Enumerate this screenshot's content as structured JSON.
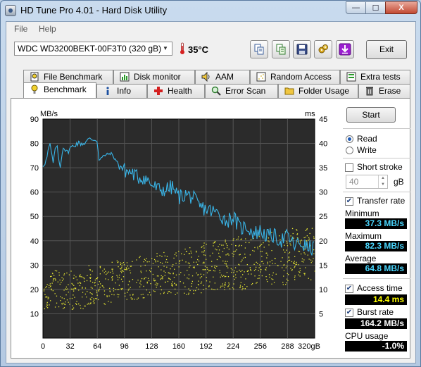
{
  "window": {
    "title": "HD Tune Pro 4.01 - Hard Disk Utility",
    "min": "—",
    "max": "☐",
    "close": "X"
  },
  "menu": {
    "file": "File",
    "help": "Help"
  },
  "toolbar": {
    "drive": "WDC WD3200BEKT-00F3T0 (320 gB)",
    "temperature": "35°C",
    "exit_label": "Exit",
    "icons": [
      "copy-icon",
      "copy-info-icon",
      "save-icon",
      "options-icon",
      "download-icon"
    ]
  },
  "tabs_top": [
    "File Benchmark",
    "Disk monitor",
    "AAM",
    "Random Access",
    "Extra tests"
  ],
  "tabs_bottom": [
    "Benchmark",
    "Info",
    "Health",
    "Error Scan",
    "Folder Usage",
    "Erase"
  ],
  "active_tab": "Benchmark",
  "side": {
    "start_label": "Start",
    "read_label": "Read",
    "write_label": "Write",
    "mode": "Read",
    "short_stroke_label": "Short stroke",
    "short_stroke_checked": false,
    "short_stroke_value": "40",
    "gb_label": "gB",
    "transfer_rate_label": "Transfer rate",
    "transfer_rate_checked": true,
    "minimum_label": "Minimum",
    "minimum_value": "37.3 MB/s",
    "maximum_label": "Maximum",
    "maximum_value": "82.3 MB/s",
    "average_label": "Average",
    "average_value": "64.8 MB/s",
    "access_time_label": "Access time",
    "access_time_checked": true,
    "access_time_value": "14.4 ms",
    "burst_rate_label": "Burst rate",
    "burst_rate_checked": true,
    "burst_rate_value": "164.2 MB/s",
    "cpu_usage_label": "CPU usage",
    "cpu_usage_value": "-1.0%"
  },
  "chart_data": {
    "type": "line",
    "left_unit": "MB/s",
    "right_unit": "ms",
    "left_ylim": [
      0,
      90
    ],
    "right_ylim": [
      0,
      45
    ],
    "xlim": [
      0,
      320
    ],
    "x_ticks": [
      "0",
      "32",
      "64",
      "96",
      "128",
      "160",
      "192",
      "224",
      "256",
      "288",
      "320gB"
    ],
    "left_ticks": [
      "10",
      "20",
      "30",
      "40",
      "50",
      "60",
      "70",
      "80",
      "90"
    ],
    "right_ticks": [
      "5",
      "10",
      "15",
      "20",
      "25",
      "30",
      "35",
      "40",
      "45"
    ],
    "grid": true,
    "colors": {
      "transfer": "#39b5e8",
      "access": "#e6e632",
      "background": "#2b2b2b",
      "grid": "#555555"
    },
    "series": [
      {
        "name": "Transfer rate",
        "x": [
          0,
          4,
          8,
          12,
          16,
          20,
          24,
          28,
          32,
          40,
          48,
          56,
          64,
          66,
          72,
          80,
          88,
          96,
          104,
          112,
          120,
          128,
          136,
          144,
          152,
          160,
          168,
          176,
          184,
          192,
          200,
          208,
          216,
          224,
          232,
          240,
          248,
          256,
          264,
          272,
          280,
          288,
          296,
          304,
          312,
          320
        ],
        "y": [
          71,
          73,
          80,
          72,
          80,
          70,
          79,
          76,
          78,
          80,
          80,
          82,
          81,
          73,
          75,
          76,
          72,
          69,
          68,
          66,
          66,
          63,
          61,
          61,
          62,
          58,
          59,
          58,
          54,
          53,
          52,
          51,
          48,
          50,
          45,
          46,
          43,
          44,
          42,
          42,
          40,
          42,
          38,
          39,
          37,
          37
        ]
      },
      {
        "name": "Access time",
        "x_range_gb": [
          0,
          320
        ],
        "y_min_ms": [
          6,
          6,
          7,
          8,
          8,
          9,
          9,
          10,
          10,
          11,
          11,
          12
        ],
        "y_max_ms": [
          14,
          14,
          15,
          16,
          17,
          18,
          19,
          20,
          21,
          21,
          22,
          23
        ],
        "points": 900
      }
    ]
  }
}
